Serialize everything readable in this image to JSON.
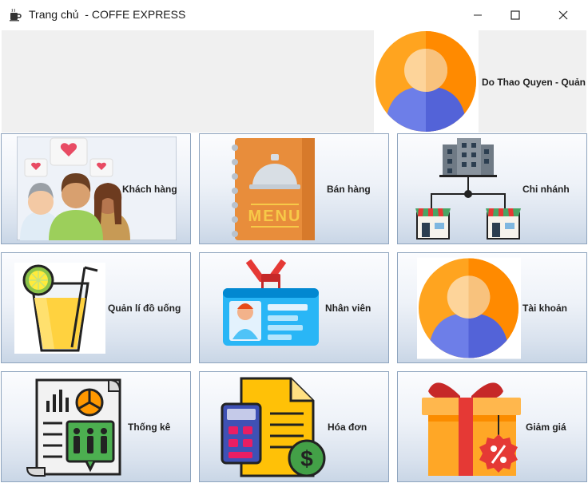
{
  "window": {
    "title": "Trang chủ  - COFFE EXPRESS",
    "icon": "coffee-app-icon",
    "controls": [
      "minimize-icon",
      "maximize-icon",
      "close-icon"
    ]
  },
  "header": {
    "user_name": "Do Thao Quyen - Quản lí",
    "avatar_icon": "user-avatar-icon"
  },
  "tiles": [
    {
      "label": "Khách hàng",
      "icon": "customers-icon"
    },
    {
      "label": "Bán hàng",
      "icon": "menu-book-icon"
    },
    {
      "label": "Chi nhánh",
      "icon": "branch-network-icon"
    },
    {
      "label": "Quản lí đồ uống",
      "icon": "drink-glass-icon"
    },
    {
      "label": "Nhân viên",
      "icon": "employee-badge-icon"
    },
    {
      "label": "Tài khoản",
      "icon": "account-avatar-icon"
    },
    {
      "label": "Thống kê",
      "icon": "statistics-report-icon"
    },
    {
      "label": "Hóa đơn",
      "icon": "invoice-calculator-icon"
    },
    {
      "label": "Giảm giá",
      "icon": "discount-gift-icon"
    }
  ],
  "colors": {
    "tile_border": "#8ea4be",
    "header_bg": "#f0f0f0",
    "avatar_orange": "#ff8c00",
    "avatar_blue": "#5a6fe0"
  }
}
